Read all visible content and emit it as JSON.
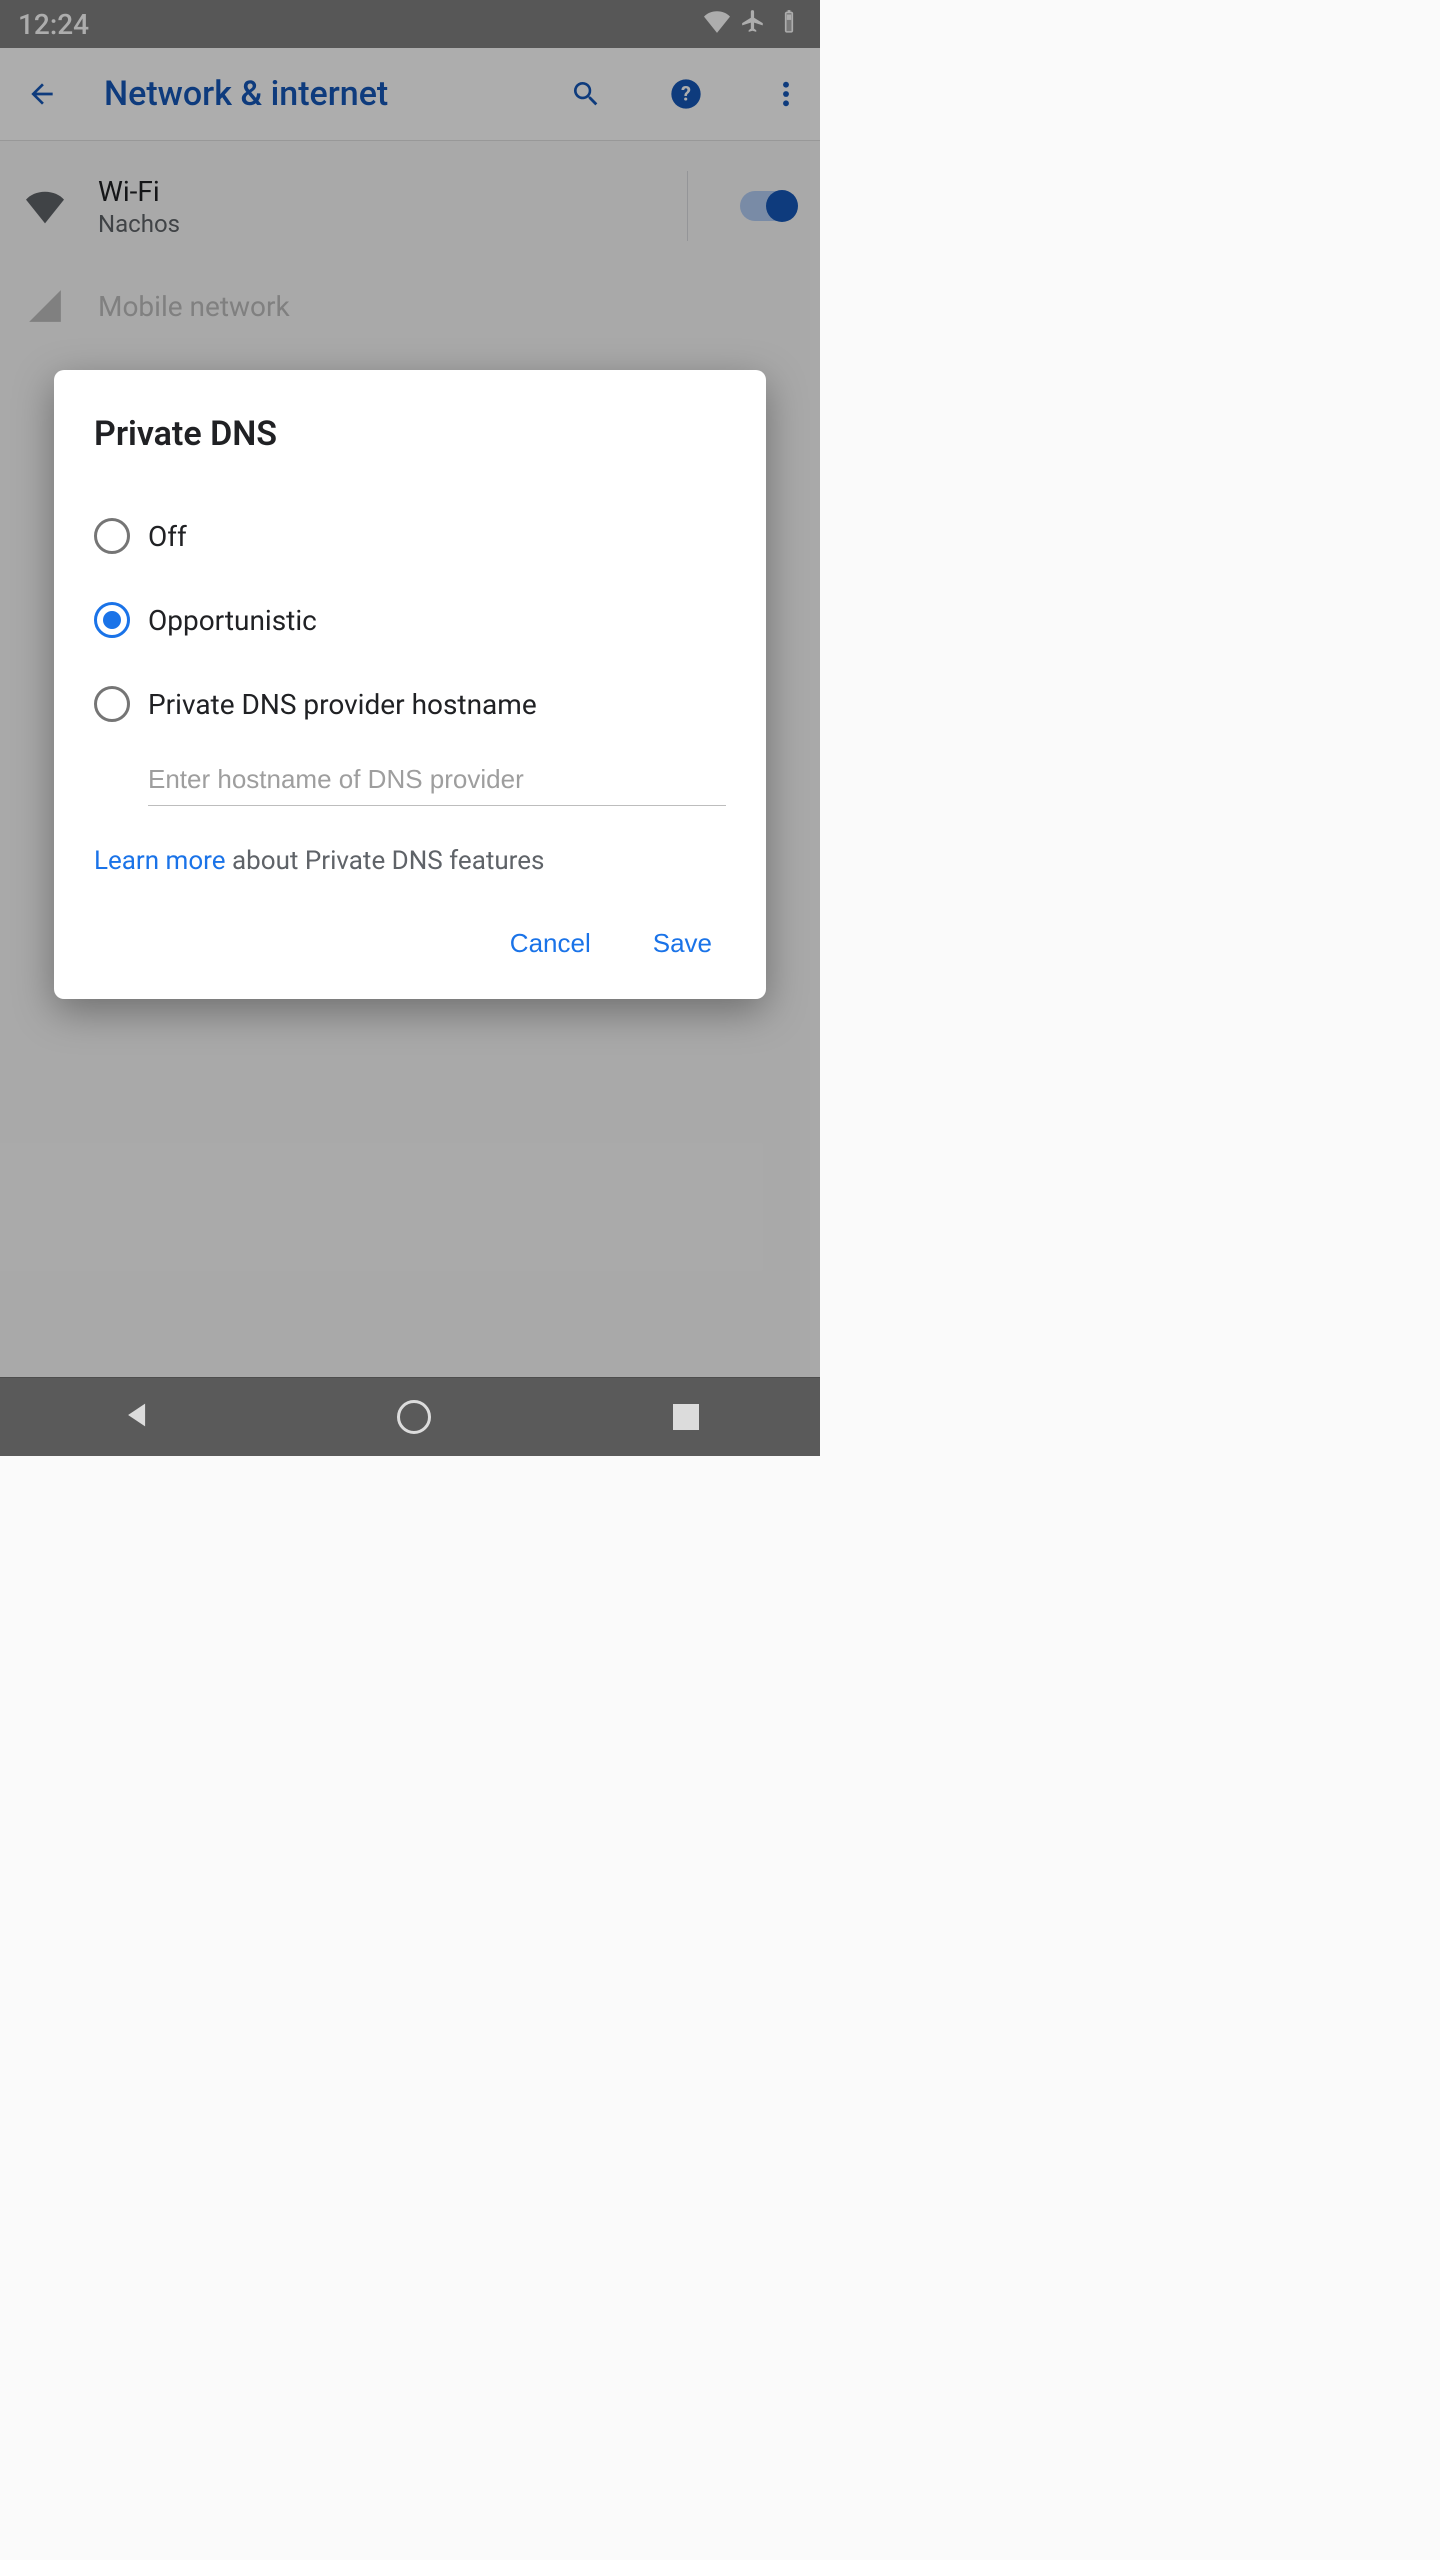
{
  "statusbar": {
    "time": "12:24"
  },
  "appbar": {
    "title": "Network & internet"
  },
  "settings": {
    "wifi": {
      "title": "Wi-Fi",
      "subtitle": "Nachos",
      "enabled": true
    },
    "mobile": {
      "title": "Mobile network"
    }
  },
  "dialog": {
    "title": "Private DNS",
    "options": {
      "off": "Off",
      "opportunistic": "Opportunistic",
      "hostname": "Private DNS provider hostname"
    },
    "selected": "opportunistic",
    "hostname_placeholder": "Enter hostname of DNS provider",
    "learn_more_link": "Learn more",
    "learn_more_rest": " about Private DNS features",
    "cancel": "Cancel",
    "save": "Save"
  }
}
